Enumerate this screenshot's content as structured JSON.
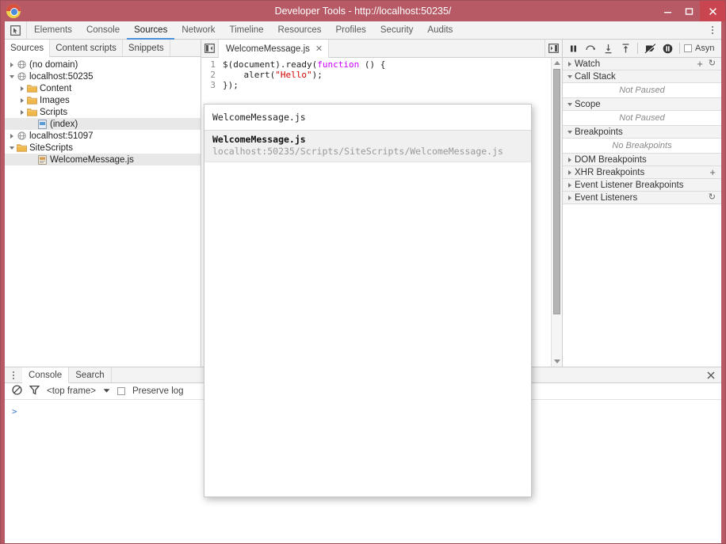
{
  "window": {
    "title": "Developer Tools - http://localhost:50235/",
    "app_icon": "chrome-icon",
    "minimize": "minimize-icon",
    "maximize": "maximize-icon",
    "close": "close-icon",
    "titlebar_color": "#b85a66",
    "close_button_color": "#c9454f"
  },
  "main_tabs": {
    "inspect_icon": "inspect-element-icon",
    "menu_icon": "vertical-dots-icon",
    "items": [
      {
        "label": "Elements",
        "active": false
      },
      {
        "label": "Console",
        "active": false
      },
      {
        "label": "Sources",
        "active": true
      },
      {
        "label": "Network",
        "active": false
      },
      {
        "label": "Timeline",
        "active": false
      },
      {
        "label": "Resources",
        "active": false
      },
      {
        "label": "Profiles",
        "active": false
      },
      {
        "label": "Security",
        "active": false
      },
      {
        "label": "Audits",
        "active": false
      }
    ],
    "active_underline_color": "#4a90d9"
  },
  "navigator": {
    "tabs": [
      {
        "label": "Sources",
        "active": true
      },
      {
        "label": "Content scripts",
        "active": false
      },
      {
        "label": "Snippets",
        "active": false
      }
    ],
    "tree": [
      {
        "label": "(no domain)",
        "icon": "globe-icon",
        "arrow": "collapsed",
        "indent": 0,
        "selected": false
      },
      {
        "label": "localhost:50235",
        "icon": "globe-icon",
        "arrow": "expanded",
        "indent": 0,
        "selected": false
      },
      {
        "label": "Content",
        "icon": "folder-icon",
        "arrow": "collapsed",
        "indent": 1,
        "selected": false
      },
      {
        "label": "Images",
        "icon": "folder-icon",
        "arrow": "collapsed",
        "indent": 1,
        "selected": false
      },
      {
        "label": "Scripts",
        "icon": "folder-icon",
        "arrow": "collapsed",
        "indent": 1,
        "selected": false
      },
      {
        "label": "(index)",
        "icon": "document-icon",
        "arrow": "none",
        "indent": 2,
        "selected": true
      },
      {
        "label": "localhost:51097",
        "icon": "globe-icon",
        "arrow": "collapsed",
        "indent": 0,
        "selected": false
      },
      {
        "label": "SiteScripts",
        "icon": "folder-icon",
        "arrow": "expanded",
        "indent": 0,
        "selected": false
      },
      {
        "label": "WelcomeMessage.js",
        "icon": "js-file-icon",
        "arrow": "none",
        "indent": 2,
        "selected": true
      }
    ]
  },
  "editor": {
    "left_toggle_icon": "show-navigator-icon",
    "right_toggle_icon": "show-debugger-icon",
    "tabs": [
      {
        "label": "WelcomeMessage.js",
        "close_icon": "close-tab-icon",
        "active": true
      }
    ],
    "lines": [
      {
        "num": "1",
        "tokens": [
          {
            "t": "$(document).ready(",
            "c": "plain"
          },
          {
            "t": "function",
            "c": "kw"
          },
          {
            "t": " () {",
            "c": "plain"
          }
        ]
      },
      {
        "num": "2",
        "tokens": [
          {
            "t": "    alert(",
            "c": "plain"
          },
          {
            "t": "\"Hello\"",
            "c": "str"
          },
          {
            "t": ");",
            "c": "plain"
          }
        ]
      },
      {
        "num": "3",
        "tokens": [
          {
            "t": "});",
            "c": "plain"
          }
        ]
      }
    ],
    "scrollbar": {
      "up_icon": "scroll-up-icon",
      "down_icon": "scroll-down-icon"
    },
    "keyword_color": "#cc00ff",
    "string_color": "#d40000"
  },
  "debugger": {
    "toolbar": [
      {
        "name": "pause-resume-button",
        "icon": "pause-icon"
      },
      {
        "name": "step-over-button",
        "icon": "step-over-icon"
      },
      {
        "name": "step-into-button",
        "icon": "step-into-icon"
      },
      {
        "name": "step-out-button",
        "icon": "step-out-icon"
      },
      {
        "name": "deactivate-breakpoints-button",
        "icon": "deactivate-breakpoints-icon"
      },
      {
        "name": "pause-on-exceptions-button",
        "icon": "pause-on-exceptions-icon"
      }
    ],
    "async_label": "Asyn",
    "sections": [
      {
        "title": "Watch",
        "expanded": false,
        "body": null,
        "plus": "+",
        "refresh": "↻"
      },
      {
        "title": "Call Stack",
        "expanded": true,
        "body": "Not Paused"
      },
      {
        "title": "Scope",
        "expanded": true,
        "body": "Not Paused"
      },
      {
        "title": "Breakpoints",
        "expanded": true,
        "body": "No Breakpoints"
      },
      {
        "title": "DOM Breakpoints",
        "expanded": false,
        "body": null
      },
      {
        "title": "XHR Breakpoints",
        "expanded": false,
        "body": null,
        "plus": "+"
      },
      {
        "title": "Event Listener Breakpoints",
        "expanded": false,
        "body": null
      },
      {
        "title": "Event Listeners",
        "expanded": false,
        "body": null,
        "refresh": "↻"
      }
    ]
  },
  "drawer": {
    "menu_icon": "vertical-dots-icon",
    "tabs": [
      {
        "label": "Console",
        "active": true
      },
      {
        "label": "Search",
        "active": false
      }
    ],
    "close_icon": "close-drawer-icon",
    "console_toolbar": {
      "clear_icon": "clear-console-icon",
      "filter_icon": "filter-icon",
      "context_value": "<top frame>",
      "context_caret": "chevron-down-icon",
      "preserve_log_label": "Preserve log",
      "preserve_log_checked": false
    },
    "prompt_symbol": ">",
    "prompt_color": "#3a7bd5"
  },
  "quick_open": {
    "input_value": "WelcomeMessage.js",
    "results": [
      {
        "name": "WelcomeMessage.js",
        "path": "localhost:50235/Scripts/SiteScripts/WelcomeMessage.js",
        "selected": true
      }
    ]
  }
}
